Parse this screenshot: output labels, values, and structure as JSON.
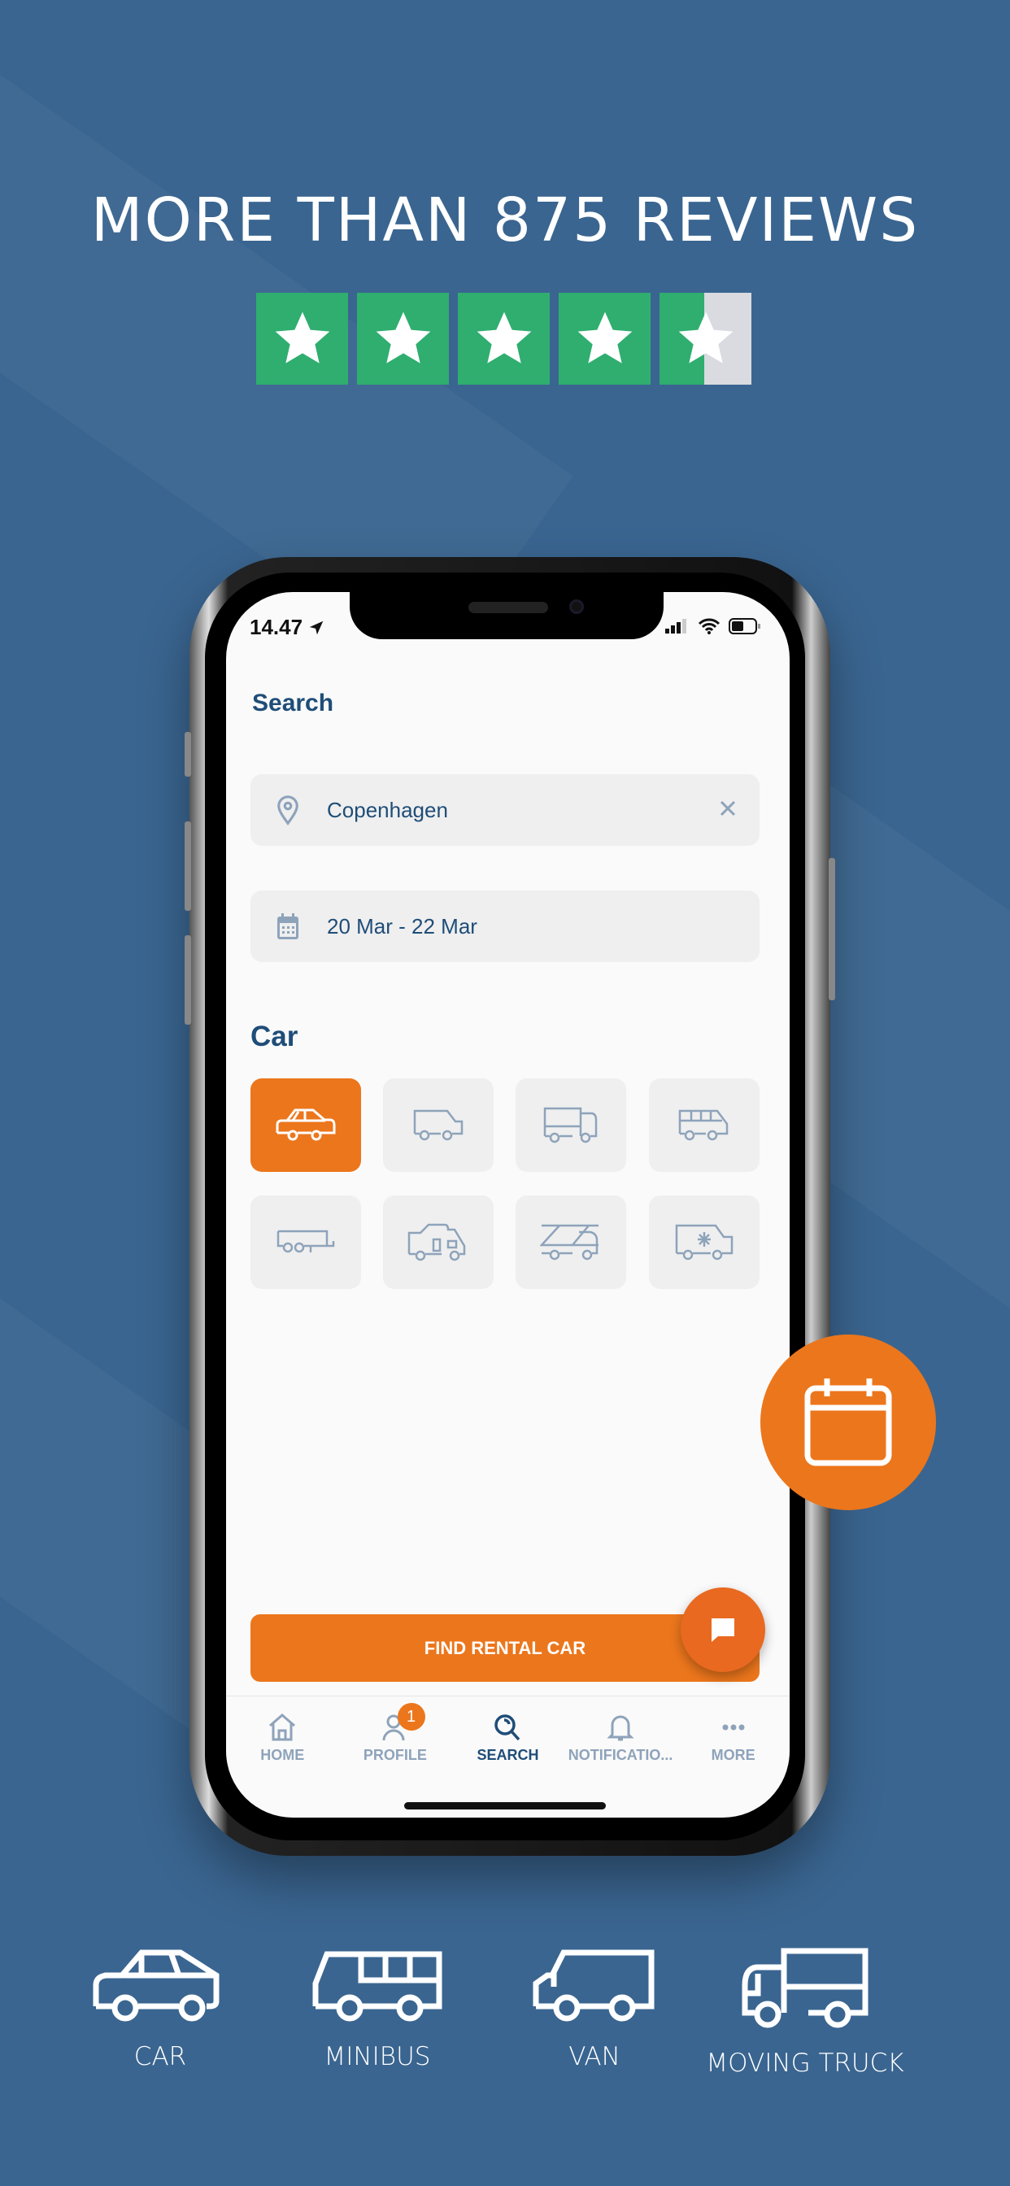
{
  "headline": "MORE THAN 875 REVIEWS",
  "rating": {
    "stars_filled": 4.5,
    "stars_total": 5,
    "color": "#2fae6f"
  },
  "status_bar": {
    "time": "14.47"
  },
  "search": {
    "title": "Search",
    "location": {
      "value": "Copenhagen",
      "icon": "map-pin-icon",
      "clear_icon": "close-icon"
    },
    "dates": {
      "value": "20 Mar - 22 Mar",
      "icon": "calendar-icon"
    }
  },
  "category": {
    "title": "Car",
    "vehicle_types": [
      {
        "icon": "car-icon",
        "selected": true
      },
      {
        "icon": "van-icon",
        "selected": false
      },
      {
        "icon": "moving-truck-icon",
        "selected": false
      },
      {
        "icon": "minibus-icon",
        "selected": false
      },
      {
        "icon": "trailer-icon",
        "selected": false
      },
      {
        "icon": "motorhome-icon",
        "selected": false
      },
      {
        "icon": "ladder-truck-icon",
        "selected": false
      },
      {
        "icon": "refrigerated-van-icon",
        "selected": false
      }
    ]
  },
  "find_button": "FIND RENTAL CAR",
  "tabs": [
    {
      "label": "HOME",
      "icon": "home-icon"
    },
    {
      "label": "PROFILE",
      "icon": "user-icon",
      "badge": "1"
    },
    {
      "label": "SEARCH",
      "icon": "search-icon",
      "active": true
    },
    {
      "label": "NOTIFICATIO...",
      "icon": "bell-icon"
    },
    {
      "label": "MORE",
      "icon": "more-icon"
    }
  ],
  "footer_types": [
    {
      "label": "CAR",
      "icon": "car-icon"
    },
    {
      "label": "MINIBUS",
      "icon": "minibus-icon"
    },
    {
      "label": "VAN",
      "icon": "van-icon"
    },
    {
      "label": "MOVING TRUCK",
      "icon": "moving-truck-icon"
    }
  ],
  "colors": {
    "background": "#3a6590",
    "accent": "#ec761c",
    "primary_text": "#1f4d78",
    "muted": "#8ea3ba"
  }
}
